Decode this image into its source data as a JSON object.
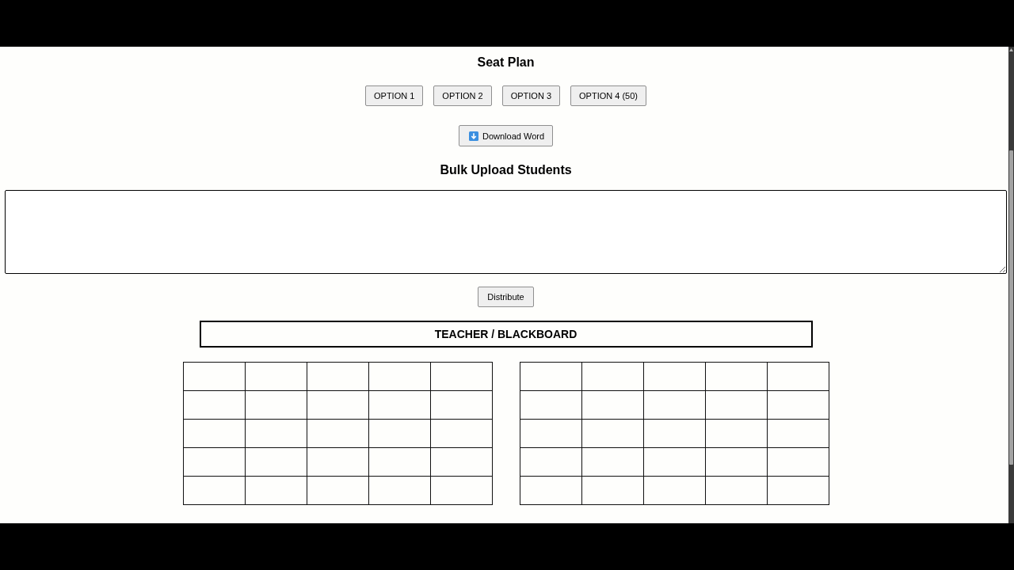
{
  "title": "Seat Plan",
  "option_buttons": [
    "OPTION 1",
    "OPTION 2",
    "OPTION 3",
    "OPTION 4 (50)"
  ],
  "download_button": {
    "label": "Download Word"
  },
  "bulk_upload": {
    "heading": "Bulk Upload Students",
    "button": "Distribute"
  },
  "teacher_board": "TEACHER / BLACKBOARD",
  "seat_blocks": [
    {
      "rows": [
        {
          "seats": [
            {
              "kind": "empty"
            },
            {
              "kind": "empty"
            },
            {
              "kind": "empty"
            },
            {
              "kind": "empty"
            },
            {
              "kind": "empty"
            }
          ]
        },
        {
          "seats": [
            {
              "kind": "empty"
            },
            {
              "kind": "empty"
            },
            {
              "kind": "empty"
            },
            {
              "kind": "empty"
            },
            {
              "kind": "empty"
            }
          ]
        },
        {
          "seats": [
            {
              "kind": "empty"
            },
            {
              "kind": "empty"
            },
            {
              "kind": "empty"
            },
            {
              "kind": "empty"
            },
            {
              "kind": "empty"
            }
          ]
        },
        {
          "seats": [
            {
              "kind": "empty"
            },
            {
              "kind": "empty"
            },
            {
              "kind": "empty"
            },
            {
              "kind": "empty"
            },
            {
              "kind": "empty"
            }
          ]
        },
        {
          "seats": [
            {
              "kind": "empty"
            },
            {
              "kind": "empty"
            },
            {
              "kind": "empty"
            },
            {
              "kind": "empty"
            },
            {
              "kind": "empty"
            }
          ]
        }
      ]
    },
    {
      "rows": [
        {
          "seats": [
            {
              "kind": "empty"
            },
            {
              "kind": "empty"
            },
            {
              "kind": "empty"
            },
            {
              "kind": "empty"
            },
            {
              "kind": "empty"
            }
          ]
        },
        {
          "seats": [
            {
              "kind": "empty"
            },
            {
              "kind": "empty"
            },
            {
              "kind": "empty"
            },
            {
              "kind": "empty"
            },
            {
              "kind": "empty"
            }
          ]
        },
        {
          "seats": [
            {
              "kind": "empty"
            },
            {
              "kind": "empty"
            },
            {
              "kind": "empty"
            },
            {
              "kind": "empty"
            },
            {
              "kind": "empty"
            }
          ]
        },
        {
          "seats": [
            {
              "kind": "empty"
            },
            {
              "kind": "empty"
            },
            {
              "kind": "empty"
            },
            {
              "kind": "empty"
            },
            {
              "kind": "empty"
            }
          ]
        },
        {
          "seats": [
            {
              "kind": "empty"
            },
            {
              "kind": "empty"
            },
            {
              "kind": "empty"
            },
            {
              "kind": "empty"
            },
            {
              "kind": "empty"
            }
          ]
        }
      ]
    }
  ]
}
